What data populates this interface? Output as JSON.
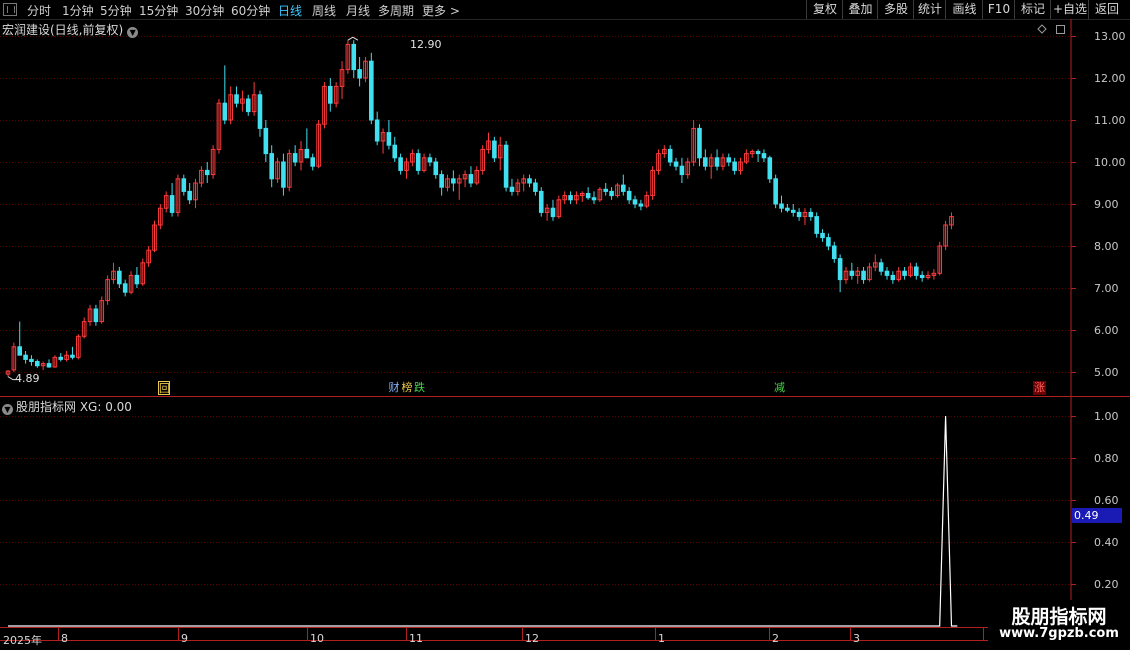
{
  "toolbar": {
    "periods": [
      "分时",
      "1分钟",
      "5分钟",
      "15分钟",
      "30分钟",
      "60分钟",
      "日线",
      "周线",
      "月线",
      "多周期",
      "更多 >"
    ],
    "active_period": "日线",
    "right_buttons": [
      "复权",
      "叠加",
      "多股",
      "统计",
      "画线",
      "F10",
      "标记",
      "+自选",
      "返回"
    ]
  },
  "kline": {
    "title": "宏润建设(日线,前复权)",
    "y_axis_labels": [
      "13.00",
      "12.00",
      "11.00",
      "10.00",
      "9.00",
      "8.00",
      "7.00",
      "6.00",
      "5.00"
    ],
    "high_label": "12.90",
    "low_label": "4.89",
    "signals": [
      {
        "text": "回",
        "color": "#e8c84a"
      },
      {
        "text": "财",
        "color": "#8ab4ff"
      },
      {
        "text": "榜",
        "color": "#e8c84a"
      },
      {
        "text": "跌",
        "color": "#4cd44c"
      },
      {
        "text": "减",
        "color": "#4cd44c"
      },
      {
        "text": "涨",
        "color": "#ff5050"
      }
    ]
  },
  "indicator": {
    "title": "股朋指标网 XG: 0.00",
    "y_axis_labels": [
      "1.00",
      "0.80",
      "0.60",
      "0.40",
      "0.20"
    ],
    "current_value": "0.49"
  },
  "time_axis": {
    "year_label": "2025年",
    "months": [
      "8",
      "9",
      "10",
      "11",
      "12",
      "1",
      "2",
      "3"
    ]
  },
  "watermark": {
    "title": "股朋指标网",
    "url": "www.7gpzb.com"
  },
  "colors": {
    "up": "#ff3b3b",
    "down": "#40e0f0",
    "grid": "#5a0000",
    "frame": "#b02020",
    "active_tab": "#3cc8ff"
  },
  "chart_data": {
    "type": "candlestick",
    "title": "宏润建设(日线,前复权)",
    "ylim": [
      4.6,
      13.2
    ],
    "candles": [
      [
        4.95,
        5.05,
        4.89,
        5.02
      ],
      [
        5.05,
        5.7,
        5.0,
        5.6
      ],
      [
        5.6,
        6.2,
        5.5,
        5.4
      ],
      [
        5.4,
        5.5,
        5.2,
        5.3
      ],
      [
        5.3,
        5.4,
        5.15,
        5.25
      ],
      [
        5.25,
        5.3,
        5.1,
        5.15
      ],
      [
        5.15,
        5.25,
        5.05,
        5.2
      ],
      [
        5.2,
        5.3,
        5.1,
        5.12
      ],
      [
        5.12,
        5.4,
        5.1,
        5.35
      ],
      [
        5.35,
        5.45,
        5.25,
        5.3
      ],
      [
        5.3,
        5.5,
        5.25,
        5.4
      ],
      [
        5.4,
        5.6,
        5.3,
        5.35
      ],
      [
        5.35,
        5.9,
        5.3,
        5.85
      ],
      [
        5.85,
        6.3,
        5.8,
        6.2
      ],
      [
        6.2,
        6.6,
        6.1,
        6.5
      ],
      [
        6.5,
        6.6,
        6.1,
        6.2
      ],
      [
        6.2,
        6.8,
        6.15,
        6.7
      ],
      [
        6.7,
        7.3,
        6.6,
        7.2
      ],
      [
        7.2,
        7.6,
        7.1,
        7.4
      ],
      [
        7.4,
        7.5,
        7.0,
        7.1
      ],
      [
        7.1,
        7.2,
        6.8,
        6.9
      ],
      [
        6.9,
        7.4,
        6.85,
        7.3
      ],
      [
        7.3,
        7.5,
        7.0,
        7.1
      ],
      [
        7.1,
        7.7,
        7.05,
        7.6
      ],
      [
        7.6,
        8.0,
        7.5,
        7.9
      ],
      [
        7.9,
        8.6,
        7.85,
        8.5
      ],
      [
        8.5,
        9.0,
        8.4,
        8.9
      ],
      [
        8.9,
        9.3,
        8.8,
        9.2
      ],
      [
        9.2,
        9.5,
        8.7,
        8.8
      ],
      [
        8.8,
        9.7,
        8.7,
        9.6
      ],
      [
        9.6,
        9.7,
        9.2,
        9.3
      ],
      [
        9.3,
        9.5,
        9.0,
        9.1
      ],
      [
        9.1,
        9.6,
        8.9,
        9.5
      ],
      [
        9.5,
        9.9,
        9.4,
        9.8
      ],
      [
        9.8,
        10.0,
        9.5,
        9.7
      ],
      [
        9.7,
        10.4,
        9.6,
        10.3
      ],
      [
        10.3,
        11.5,
        10.2,
        11.4
      ],
      [
        11.4,
        12.3,
        10.9,
        11.0
      ],
      [
        11.0,
        11.8,
        10.9,
        11.6
      ],
      [
        11.6,
        11.8,
        11.3,
        11.4
      ],
      [
        11.4,
        11.7,
        11.2,
        11.5
      ],
      [
        11.5,
        11.6,
        11.1,
        11.2
      ],
      [
        11.2,
        11.9,
        11.1,
        11.6
      ],
      [
        11.6,
        11.7,
        10.6,
        10.8
      ],
      [
        10.8,
        11.0,
        10.0,
        10.2
      ],
      [
        10.2,
        10.4,
        9.4,
        9.6
      ],
      [
        9.6,
        10.1,
        9.5,
        10.0
      ],
      [
        10.0,
        10.2,
        9.2,
        9.4
      ],
      [
        9.4,
        10.3,
        9.3,
        10.2
      ],
      [
        10.2,
        10.4,
        9.9,
        10.0
      ],
      [
        10.0,
        10.5,
        9.8,
        10.3
      ],
      [
        10.3,
        10.8,
        10.2,
        10.1
      ],
      [
        10.1,
        10.2,
        9.8,
        9.9
      ],
      [
        9.9,
        11.0,
        9.85,
        10.9
      ],
      [
        10.9,
        11.9,
        10.8,
        11.8
      ],
      [
        11.8,
        12.0,
        11.2,
        11.4
      ],
      [
        11.4,
        11.9,
        11.3,
        11.8
      ],
      [
        11.8,
        12.4,
        11.5,
        12.2
      ],
      [
        12.2,
        12.9,
        12.1,
        12.8
      ],
      [
        12.8,
        12.9,
        12.0,
        12.2
      ],
      [
        12.2,
        12.5,
        11.8,
        12.0
      ],
      [
        12.0,
        12.5,
        11.9,
        12.4
      ],
      [
        12.4,
        12.6,
        10.9,
        11.0
      ],
      [
        11.0,
        11.2,
        10.4,
        10.5
      ],
      [
        10.5,
        10.8,
        10.2,
        10.7
      ],
      [
        10.7,
        11.0,
        10.3,
        10.4
      ],
      [
        10.4,
        10.6,
        10.0,
        10.1
      ],
      [
        10.1,
        10.2,
        9.7,
        9.8
      ],
      [
        9.8,
        10.1,
        9.6,
        10.0
      ],
      [
        10.0,
        10.3,
        9.9,
        10.2
      ],
      [
        10.2,
        10.3,
        9.7,
        9.8
      ],
      [
        9.8,
        10.2,
        9.75,
        10.1
      ],
      [
        10.1,
        10.2,
        9.9,
        10.0
      ],
      [
        10.0,
        10.1,
        9.6,
        9.7
      ],
      [
        9.7,
        9.8,
        9.2,
        9.4
      ],
      [
        9.4,
        9.7,
        9.3,
        9.6
      ],
      [
        9.6,
        9.8,
        9.3,
        9.5
      ],
      [
        9.5,
        9.7,
        9.1,
        9.6
      ],
      [
        9.6,
        9.8,
        9.4,
        9.7
      ],
      [
        9.7,
        9.9,
        9.4,
        9.5
      ],
      [
        9.5,
        9.9,
        9.45,
        9.8
      ],
      [
        9.8,
        10.4,
        9.7,
        10.3
      ],
      [
        10.3,
        10.7,
        10.2,
        10.5
      ],
      [
        10.5,
        10.6,
        10.0,
        10.1
      ],
      [
        10.1,
        10.6,
        9.8,
        10.4
      ],
      [
        10.4,
        10.5,
        9.3,
        9.4
      ],
      [
        9.4,
        9.6,
        9.2,
        9.3
      ],
      [
        9.3,
        9.6,
        9.2,
        9.5
      ],
      [
        9.5,
        9.7,
        9.3,
        9.6
      ],
      [
        9.6,
        9.7,
        9.4,
        9.5
      ],
      [
        9.5,
        9.6,
        9.2,
        9.3
      ],
      [
        9.3,
        9.4,
        8.7,
        8.8
      ],
      [
        8.8,
        9.0,
        8.6,
        8.9
      ],
      [
        8.9,
        9.1,
        8.6,
        8.7
      ],
      [
        8.7,
        9.2,
        8.65,
        9.1
      ],
      [
        9.1,
        9.3,
        9.0,
        9.2
      ],
      [
        9.2,
        9.3,
        9.0,
        9.1
      ],
      [
        9.1,
        9.3,
        9.0,
        9.2
      ],
      [
        9.2,
        9.3,
        9.05,
        9.25
      ],
      [
        9.25,
        9.4,
        9.1,
        9.15
      ],
      [
        9.15,
        9.3,
        9.0,
        9.1
      ],
      [
        9.1,
        9.4,
        9.05,
        9.35
      ],
      [
        9.35,
        9.5,
        9.2,
        9.3
      ],
      [
        9.3,
        9.4,
        9.1,
        9.2
      ],
      [
        9.2,
        9.5,
        9.15,
        9.45
      ],
      [
        9.45,
        9.7,
        9.2,
        9.3
      ],
      [
        9.3,
        9.4,
        9.0,
        9.1
      ],
      [
        9.1,
        9.2,
        8.9,
        9.0
      ],
      [
        9.0,
        9.1,
        8.85,
        8.95
      ],
      [
        8.95,
        9.3,
        8.9,
        9.2
      ],
      [
        9.2,
        9.9,
        9.1,
        9.8
      ],
      [
        9.8,
        10.3,
        9.7,
        10.2
      ],
      [
        10.2,
        10.4,
        10.1,
        10.3
      ],
      [
        10.3,
        10.4,
        9.9,
        10.0
      ],
      [
        10.0,
        10.1,
        9.8,
        9.9
      ],
      [
        9.9,
        10.1,
        9.5,
        9.7
      ],
      [
        9.7,
        10.1,
        9.6,
        10.0
      ],
      [
        10.0,
        11.0,
        9.9,
        10.8
      ],
      [
        10.8,
        10.9,
        9.9,
        10.1
      ],
      [
        10.1,
        10.3,
        9.8,
        9.9
      ],
      [
        9.9,
        10.2,
        9.6,
        10.1
      ],
      [
        10.1,
        10.3,
        9.8,
        9.9
      ],
      [
        9.9,
        10.2,
        9.8,
        10.1
      ],
      [
        10.1,
        10.2,
        9.9,
        10.0
      ],
      [
        10.0,
        10.1,
        9.7,
        9.8
      ],
      [
        9.8,
        10.1,
        9.7,
        10.0
      ],
      [
        10.0,
        10.3,
        9.95,
        10.2
      ],
      [
        10.2,
        10.3,
        10.1,
        10.25
      ],
      [
        10.25,
        10.3,
        10.0,
        10.2
      ],
      [
        10.2,
        10.3,
        10.0,
        10.1
      ],
      [
        10.1,
        10.15,
        9.5,
        9.6
      ],
      [
        9.6,
        9.7,
        8.9,
        9.0
      ],
      [
        9.0,
        9.2,
        8.8,
        8.9
      ],
      [
        8.9,
        9.0,
        8.8,
        8.85
      ],
      [
        8.85,
        9.0,
        8.7,
        8.8
      ],
      [
        8.8,
        8.9,
        8.6,
        8.7
      ],
      [
        8.7,
        8.9,
        8.5,
        8.8
      ],
      [
        8.8,
        8.9,
        8.6,
        8.7
      ],
      [
        8.7,
        8.8,
        8.2,
        8.3
      ],
      [
        8.3,
        8.4,
        8.1,
        8.2
      ],
      [
        8.2,
        8.3,
        7.9,
        8.0
      ],
      [
        8.0,
        8.1,
        7.6,
        7.7
      ],
      [
        7.7,
        7.8,
        6.9,
        7.2
      ],
      [
        7.2,
        7.5,
        7.1,
        7.4
      ],
      [
        7.4,
        7.6,
        7.2,
        7.3
      ],
      [
        7.3,
        7.5,
        7.1,
        7.4
      ],
      [
        7.4,
        7.5,
        7.1,
        7.2
      ],
      [
        7.2,
        7.6,
        7.15,
        7.5
      ],
      [
        7.5,
        7.8,
        7.4,
        7.6
      ],
      [
        7.6,
        7.7,
        7.3,
        7.4
      ],
      [
        7.4,
        7.5,
        7.2,
        7.3
      ],
      [
        7.3,
        7.4,
        7.1,
        7.2
      ],
      [
        7.2,
        7.5,
        7.15,
        7.4
      ],
      [
        7.4,
        7.5,
        7.2,
        7.3
      ],
      [
        7.3,
        7.6,
        7.25,
        7.5
      ],
      [
        7.5,
        7.6,
        7.2,
        7.3
      ],
      [
        7.3,
        7.4,
        7.15,
        7.25
      ],
      [
        7.25,
        7.4,
        7.2,
        7.3
      ],
      [
        7.3,
        7.45,
        7.2,
        7.35
      ],
      [
        7.35,
        8.1,
        7.3,
        8.0
      ],
      [
        8.0,
        8.6,
        7.9,
        8.5
      ],
      [
        8.5,
        8.8,
        8.4,
        8.7
      ]
    ],
    "indicator_values": [
      0,
      0,
      0,
      0,
      0,
      0,
      0,
      0,
      0,
      0,
      0,
      0,
      0,
      0,
      0,
      0,
      0,
      0,
      0,
      0,
      0,
      0,
      0,
      0,
      0,
      0,
      0,
      0,
      0,
      0,
      0,
      0,
      0,
      0,
      0,
      0,
      0,
      0,
      0,
      0,
      0,
      0,
      0,
      0,
      0,
      0,
      0,
      0,
      0,
      0,
      0,
      0,
      0,
      0,
      0,
      0,
      0,
      0,
      0,
      0,
      0,
      0,
      0,
      0,
      0,
      0,
      0,
      0,
      0,
      0,
      0,
      0,
      0,
      0,
      0,
      0,
      0,
      0,
      0,
      0,
      0,
      0,
      0,
      0,
      0,
      0,
      0,
      0,
      0,
      0,
      0,
      0,
      0,
      0,
      0,
      0,
      0,
      0,
      0,
      0,
      0,
      0,
      0,
      0,
      0,
      0,
      0,
      0,
      0,
      0,
      0,
      0,
      0,
      0,
      0,
      0,
      0,
      0,
      0,
      0,
      0,
      0,
      0,
      0,
      0,
      0,
      0,
      0,
      0,
      0,
      0,
      0,
      0,
      0,
      0,
      0,
      0,
      0,
      0,
      0,
      0,
      0,
      0,
      0,
      0,
      0,
      0,
      0,
      0,
      0,
      0,
      0,
      0,
      0,
      0,
      0,
      0,
      0,
      0,
      0,
      1,
      0,
      0
    ],
    "indicator_ylim": [
      0,
      1.1
    ]
  }
}
